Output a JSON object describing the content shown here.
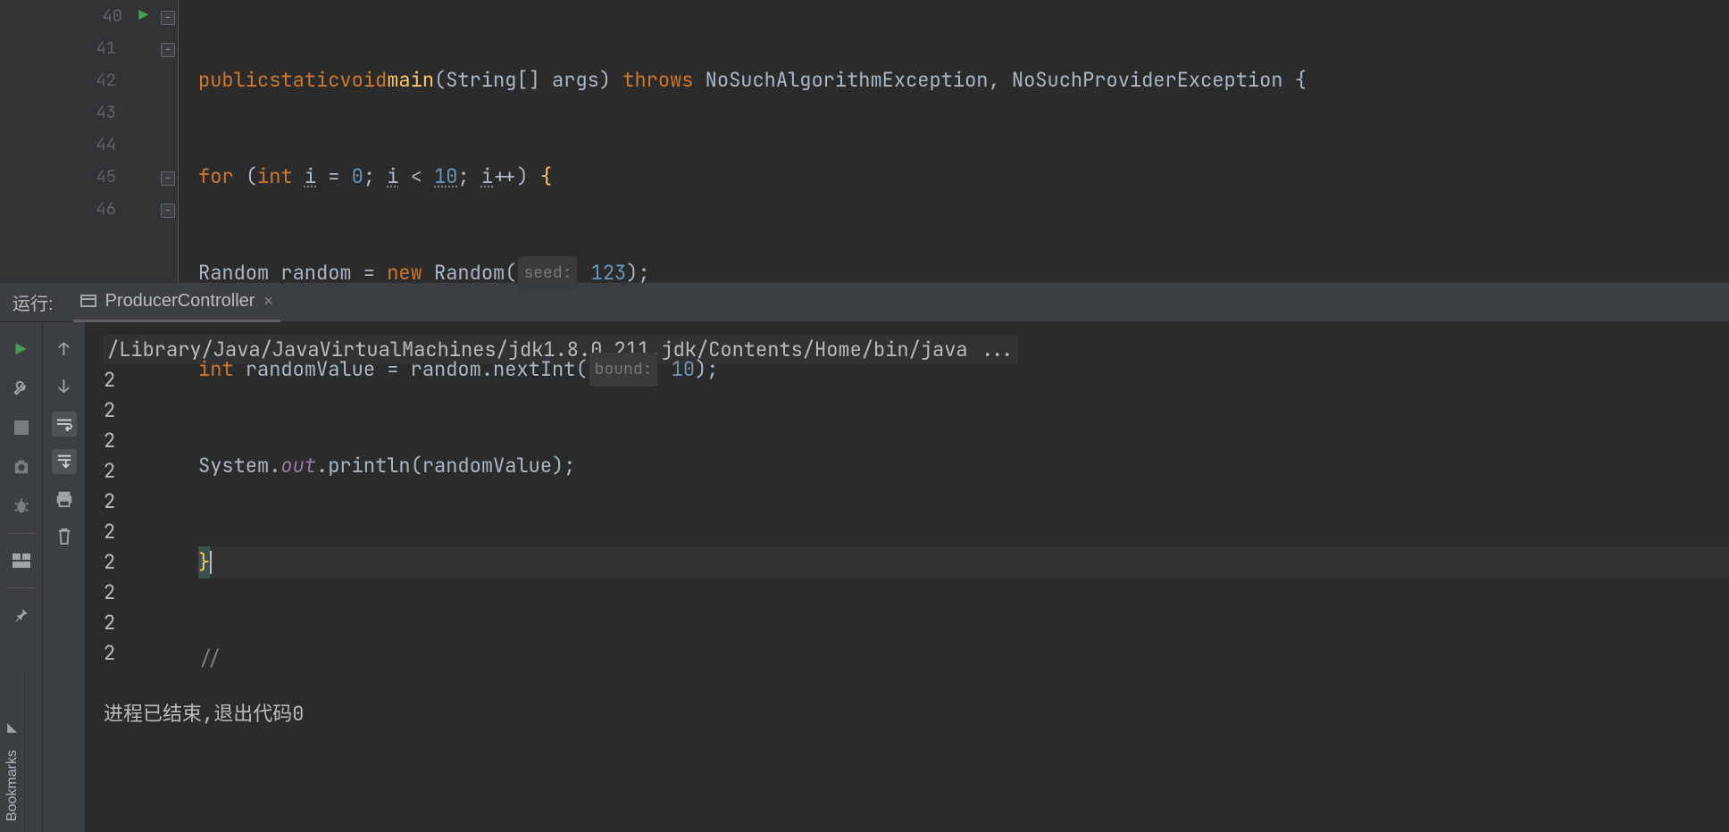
{
  "bookmarks_label": "Bookmarks",
  "gutter": {
    "start": 40,
    "end": 46
  },
  "code": {
    "l40": {
      "public": "public",
      "static": "static",
      "void": "void",
      "main": "main",
      "lp": "(",
      "string": "String",
      "br": "[] ",
      "args": "args",
      "rp": ") ",
      "throws": "throws ",
      "ex1": "NoSuchAlgorithmException",
      "comma": ", ",
      "ex2": "NoSuchProviderException ",
      "brace": "{"
    },
    "l41": {
      "for": "for ",
      "lp": "(",
      "int": "int ",
      "i": "i",
      "eq": " = ",
      "zero": "0",
      "sc1": "; ",
      "i2": "i",
      "lt": " < ",
      "ten": "10",
      "sc2": "; ",
      "i3": "i",
      "pp": "++) ",
      "brace": "{"
    },
    "l42": {
      "Random": "Random ",
      "var": "random",
      "eq": " = ",
      "new": "new ",
      "ctor": "Random",
      "lp": "(",
      "hint": "seed:",
      "sp": " ",
      "val": "123",
      "rp": ");"
    },
    "l43": {
      "int": "int ",
      "var": "randomValue",
      "eq": " = ",
      "obj": "random",
      "dot": ".",
      "m": "nextInt",
      "lp": "(",
      "hint": "bound:",
      "sp": " ",
      "val": "10",
      "rp": ");"
    },
    "l44": {
      "sys": "System",
      "dot1": ".",
      "out": "out",
      "dot2": ".",
      "m": "println",
      "lp": "(",
      "arg": "randomValue",
      "rp": ");"
    },
    "l45": {
      "brace": "}"
    },
    "l46": {
      "cmt": "//"
    }
  },
  "run": {
    "label": "运行:",
    "tab": "ProducerController",
    "command": "/Library/Java/JavaVirtualMachines/jdk1.8.0_211.jdk/Contents/Home/bin/java ...",
    "output": [
      "2",
      "2",
      "2",
      "2",
      "2",
      "2",
      "2",
      "2",
      "2",
      "2"
    ],
    "exit_msg": "进程已结束,退出代码0"
  }
}
